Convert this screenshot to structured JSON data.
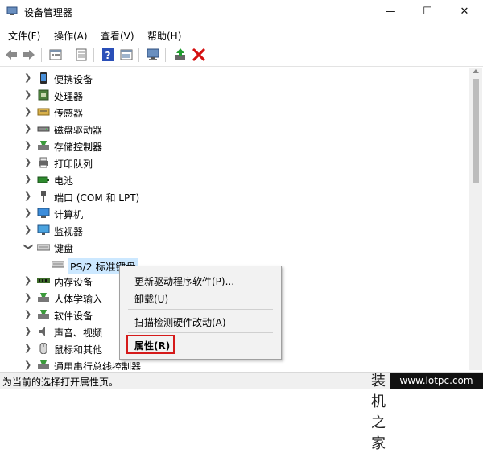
{
  "window": {
    "title": "设备管理器",
    "minimize": "—",
    "maximize": "☐",
    "close": "✕"
  },
  "menubar": [
    "文件(F)",
    "操作(A)",
    "查看(V)",
    "帮助(H)"
  ],
  "tree": [
    {
      "label": "便携设备",
      "expanded": false,
      "icon": "portable-device-icon"
    },
    {
      "label": "处理器",
      "expanded": false,
      "icon": "processor-icon"
    },
    {
      "label": "传感器",
      "expanded": false,
      "icon": "sensor-icon"
    },
    {
      "label": "磁盘驱动器",
      "expanded": false,
      "icon": "disk-drive-icon"
    },
    {
      "label": "存储控制器",
      "expanded": false,
      "icon": "storage-controller-icon"
    },
    {
      "label": "打印队列",
      "expanded": false,
      "icon": "printer-icon"
    },
    {
      "label": "电池",
      "expanded": false,
      "icon": "battery-icon"
    },
    {
      "label": "端口 (COM 和 LPT)",
      "expanded": false,
      "icon": "port-icon"
    },
    {
      "label": "计算机",
      "expanded": false,
      "icon": "computer-icon"
    },
    {
      "label": "监视器",
      "expanded": false,
      "icon": "monitor-icon"
    },
    {
      "label": "键盘",
      "expanded": true,
      "icon": "keyboard-icon"
    },
    {
      "label": "PS/2 标准键盘",
      "child": true,
      "icon": "keyboard-icon"
    },
    {
      "label": "内存设备",
      "expanded": false,
      "icon": "memory-icon"
    },
    {
      "label": "人体学输入",
      "expanded": false,
      "icon": "hid-icon"
    },
    {
      "label": "软件设备",
      "expanded": false,
      "icon": "software-device-icon"
    },
    {
      "label": "声音、视频",
      "expanded": false,
      "icon": "sound-icon"
    },
    {
      "label": "鼠标和其他",
      "expanded": false,
      "icon": "mouse-icon"
    },
    {
      "label": "通用串行总线控制器",
      "expanded": false,
      "icon": "usb-icon"
    }
  ],
  "context_menu": {
    "update_driver": "更新驱动程序软件(P)...",
    "uninstall": "卸载(U)",
    "scan": "扫描检测硬件改动(A)",
    "properties": "属性(R)"
  },
  "status": "为当前的选择打开属性页。",
  "watermark": {
    "cn": "装机之家",
    "url": "www.lotpc.com"
  }
}
